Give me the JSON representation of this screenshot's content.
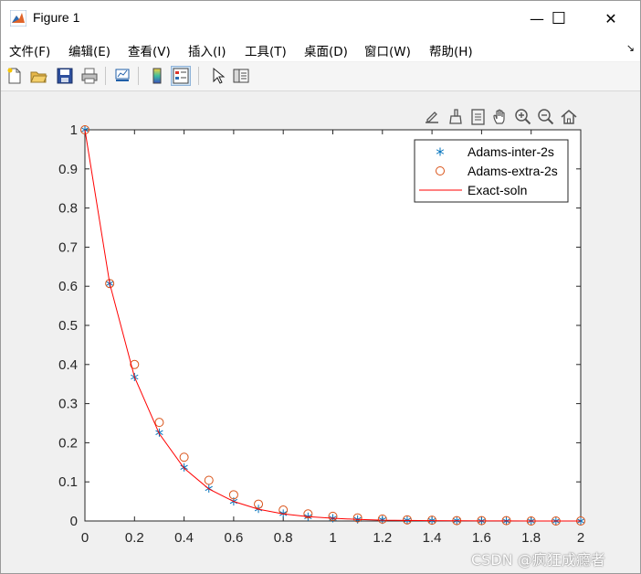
{
  "window": {
    "title": "Figure 1",
    "minimize": "—",
    "maximize": "☐",
    "close": "✕"
  },
  "menu": [
    "文件(F)",
    "编辑(E)",
    "查看(V)",
    "插入(I)",
    "工具(T)",
    "桌面(D)",
    "窗口(W)",
    "帮助(H)"
  ],
  "toolbar": {
    "icons": [
      "new-figure-icon",
      "open-file-icon",
      "save-icon",
      "print-icon",
      "link-plot-icon",
      "colorbar-icon",
      "legend-icon",
      "edit-plot-icon",
      "property-editor-icon"
    ]
  },
  "axes_toolbar": {
    "icons": [
      "export-icon",
      "brush-icon",
      "data-tips-icon",
      "pan-icon",
      "zoom-in-icon",
      "zoom-out-icon",
      "restore-view-icon"
    ]
  },
  "chart_data": {
    "type": "line",
    "title": "",
    "xlabel": "",
    "ylabel": "",
    "xlim": [
      0,
      2
    ],
    "ylim": [
      0,
      1
    ],
    "xticks": [
      "0",
      "0.2",
      "0.4",
      "0.6",
      "0.8",
      "1",
      "1.2",
      "1.4",
      "1.6",
      "1.8",
      "2"
    ],
    "yticks": [
      "0",
      "0.1",
      "0.2",
      "0.3",
      "0.4",
      "0.5",
      "0.6",
      "0.7",
      "0.8",
      "0.9",
      "1"
    ],
    "grid": false,
    "legend_position": "top-right",
    "x": [
      0,
      0.1,
      0.2,
      0.3,
      0.4,
      0.5,
      0.6,
      0.7,
      0.8,
      0.9,
      1.0,
      1.1,
      1.2,
      1.3,
      1.4,
      1.5,
      1.6,
      1.7,
      1.8,
      1.9,
      2.0
    ],
    "series": [
      {
        "name": "Adams-inter-2s",
        "marker": "asterisk",
        "color": "#0072bd",
        "values": [
          1.0,
          0.607,
          0.368,
          0.226,
          0.137,
          0.083,
          0.05,
          0.031,
          0.019,
          0.011,
          0.007,
          0.004,
          0.003,
          0.002,
          0.001,
          0.001,
          0.0,
          0.0,
          0.0,
          0.0,
          0.0
        ]
      },
      {
        "name": "Adams-extra-2s",
        "marker": "circle",
        "color": "#d95319",
        "values": [
          1.0,
          0.607,
          0.4,
          0.252,
          0.163,
          0.104,
          0.067,
          0.043,
          0.028,
          0.018,
          0.012,
          0.008,
          0.005,
          0.003,
          0.002,
          0.001,
          0.001,
          0.001,
          0.0,
          0.0,
          0.0
        ]
      },
      {
        "name": "Exact-soln",
        "marker": "line",
        "color": "#ff0000",
        "values": [
          1.0,
          0.607,
          0.368,
          0.223,
          0.135,
          0.082,
          0.05,
          0.03,
          0.018,
          0.011,
          0.007,
          0.004,
          0.002,
          0.0015,
          0.0009,
          0.0006,
          0.0003,
          0.0002,
          0.0001,
          0.0001,
          0.0
        ]
      }
    ]
  },
  "watermark": "CSDN @疯狂成瘾者"
}
